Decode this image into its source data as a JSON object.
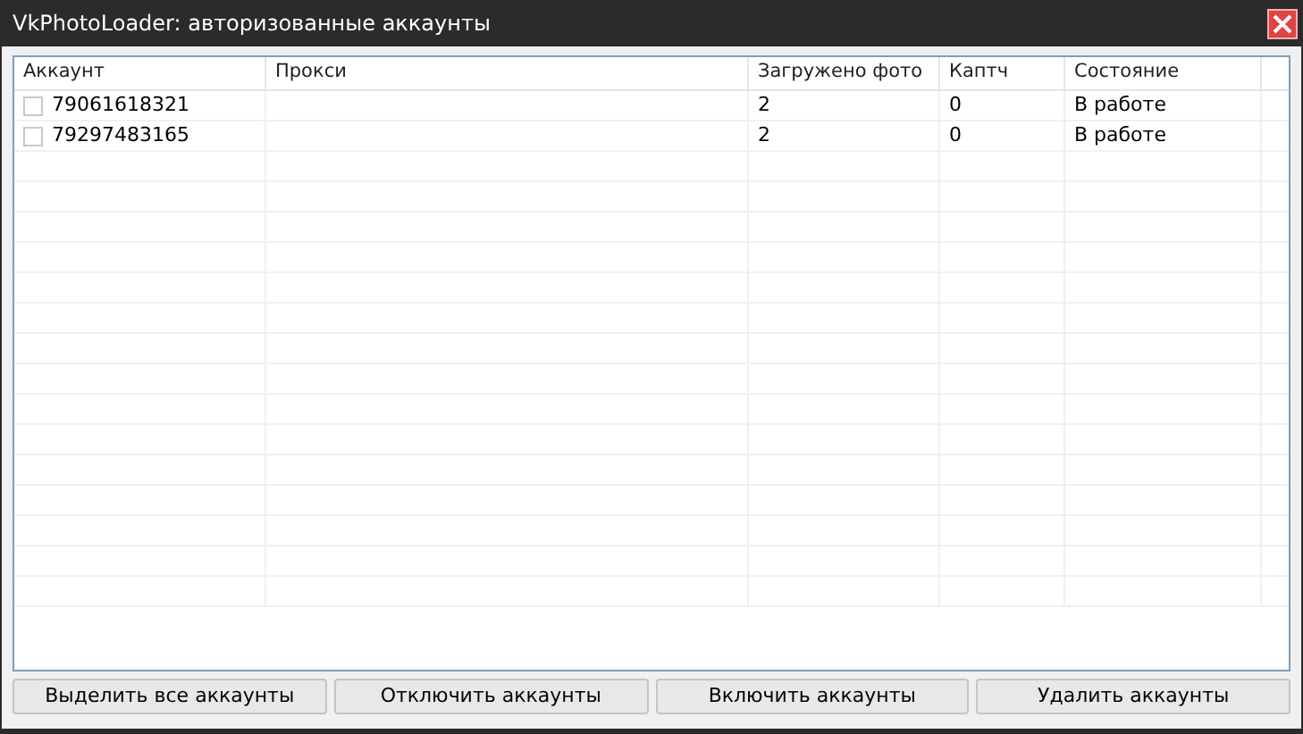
{
  "window": {
    "title": "VkPhotoLoader: авторизованные аккаунты"
  },
  "table": {
    "columns": [
      "Аккаунт",
      "Прокси",
      "Загружено фото",
      "Каптч",
      "Состояние"
    ],
    "rows": [
      {
        "checked": false,
        "cells": [
          "79061618321",
          "",
          "2",
          "0",
          "В работе"
        ]
      },
      {
        "checked": false,
        "cells": [
          "79297483165",
          "",
          "2",
          "0",
          "В работе"
        ]
      }
    ]
  },
  "buttons": [
    "Выделить все аккаунты",
    "Отключить аккаунты",
    "Включить аккаунты",
    "Удалить аккаунты"
  ]
}
